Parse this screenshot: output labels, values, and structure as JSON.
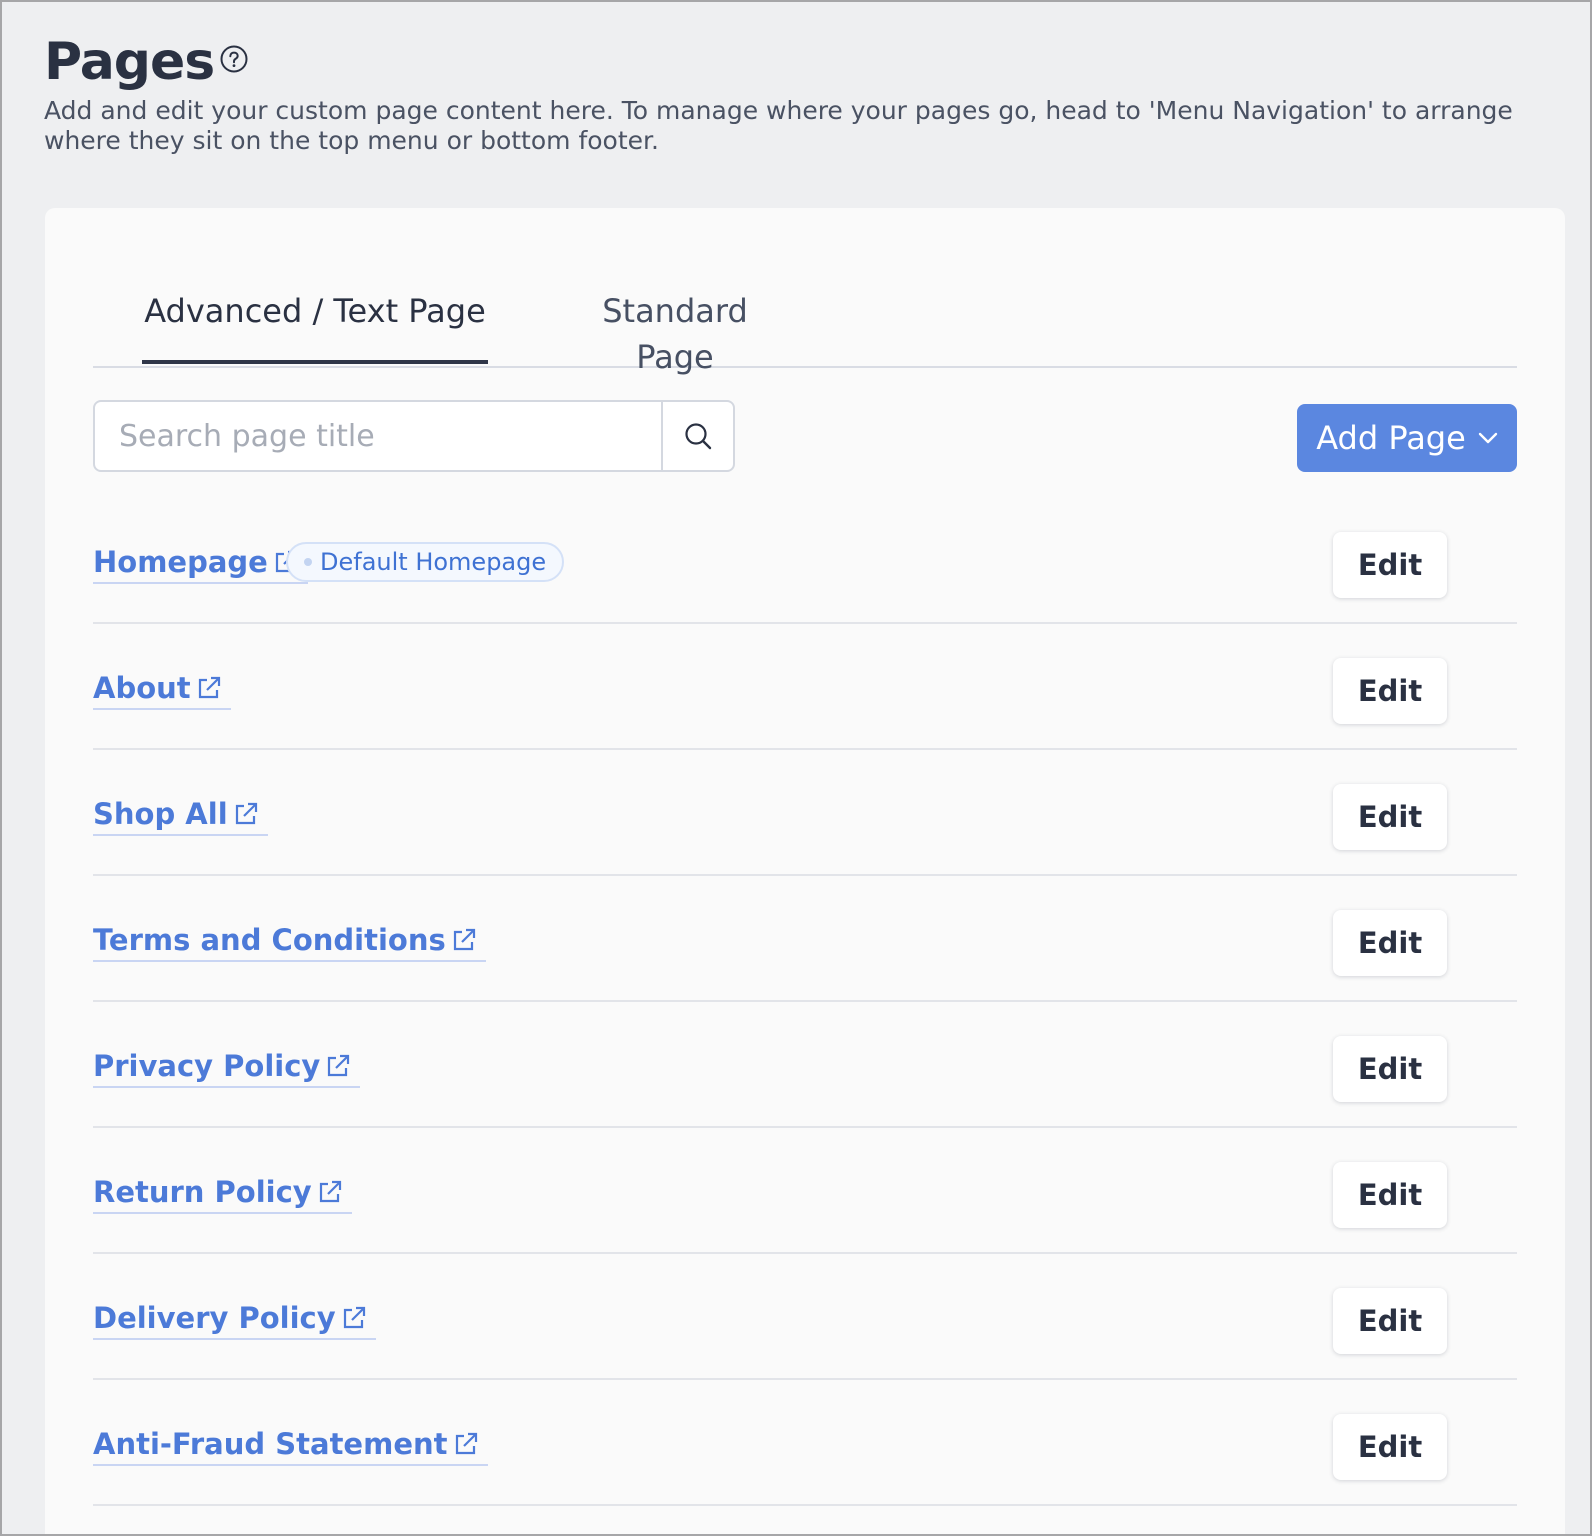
{
  "header": {
    "title": "Pages",
    "help_icon": "question-circle-icon",
    "description": "Add and edit your custom page content here. To manage where your pages go, head to 'Menu Navigation' to arrange where they sit on the top menu or bottom footer."
  },
  "tabs": [
    {
      "label": "Advanced / Text Page",
      "active": true
    },
    {
      "label": "Standard Page",
      "active": false
    }
  ],
  "search": {
    "placeholder": "Search page title",
    "value": "",
    "icon": "search-icon"
  },
  "add_page": {
    "label": "Add Page",
    "icon": "chevron-down-icon"
  },
  "pages": [
    {
      "title": "Homepage",
      "badge": "Default Homepage",
      "edit_label": "Edit"
    },
    {
      "title": "About",
      "edit_label": "Edit"
    },
    {
      "title": "Shop All",
      "edit_label": "Edit"
    },
    {
      "title": "Terms and Conditions",
      "edit_label": "Edit"
    },
    {
      "title": "Privacy Policy",
      "edit_label": "Edit"
    },
    {
      "title": "Return Policy",
      "edit_label": "Edit"
    },
    {
      "title": "Delivery Policy",
      "edit_label": "Edit"
    },
    {
      "title": "Anti-Fraud Statement",
      "edit_label": "Edit"
    }
  ],
  "colors": {
    "accent": "#5b87e0",
    "link": "#4c7ad8",
    "title": "#2a3142",
    "background": "#eeeff1",
    "card": "#fafafa"
  }
}
